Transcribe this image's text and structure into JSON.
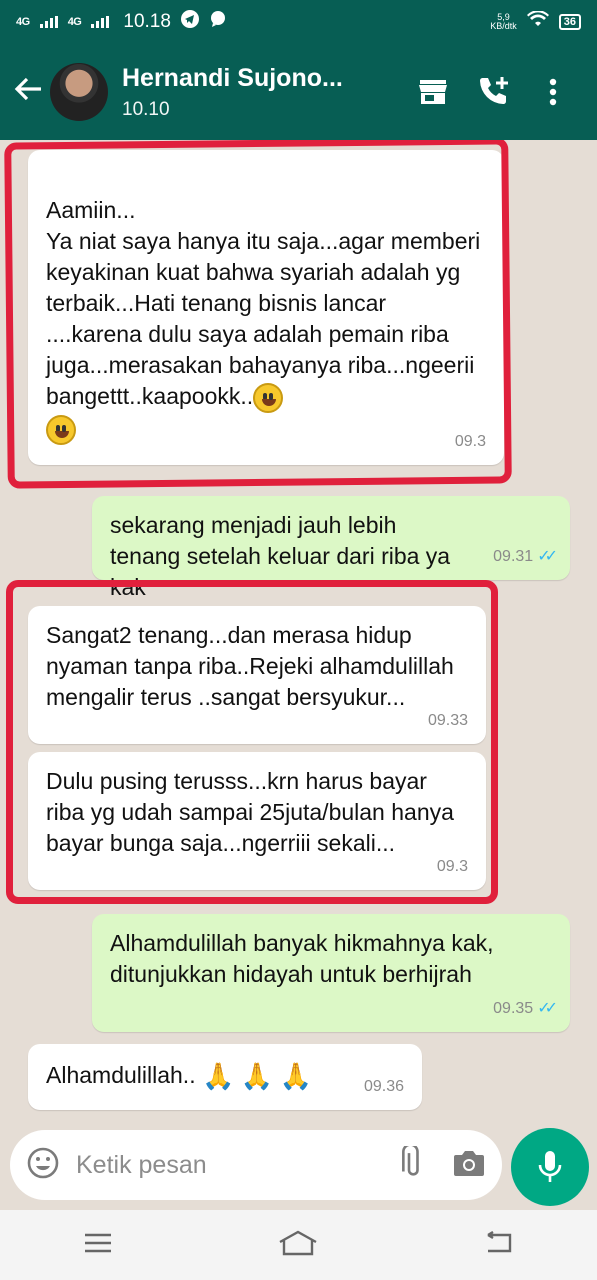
{
  "status_bar": {
    "network1": "4G",
    "network2": "4G",
    "time": "10.18",
    "speed_value": "5,9",
    "speed_unit": "KB/dtk",
    "battery": "36"
  },
  "header": {
    "contact_name": "Hernandi Sujono...",
    "last_seen": "10.10"
  },
  "messages": [
    {
      "id": "m1",
      "direction": "incoming",
      "text": "Aamiin...\nYa niat saya hanya itu saja...agar memberi keyakinan kuat bahwa syariah adalah yg terbaik...Hati tenang bisnis lancar  ....karena dulu saya adalah pemain riba juga...merasakan bahayanya riba...ngeerii bangettt..kaapookk..",
      "emoji_count": 2,
      "time": "09.3"
    },
    {
      "id": "m2",
      "direction": "outgoing",
      "text": "sekarang menjadi jauh lebih tenang setelah keluar dari riba ya kak",
      "time": "09.31",
      "read": true
    },
    {
      "id": "m3",
      "direction": "incoming",
      "text": "Sangat2 tenang...dan merasa hidup nyaman tanpa riba..Rejeki alhamdulillah mengalir terus ..sangat bersyukur...",
      "time": "09.33"
    },
    {
      "id": "m4",
      "direction": "incoming",
      "text": "Dulu pusing terusss...krn harus bayar riba yg udah sampai 25juta/bulan hanya bayar bunga saja...ngerriii sekali...",
      "time": "09.3"
    },
    {
      "id": "m5",
      "direction": "outgoing",
      "text": "Alhamdulillah banyak hikmahnya kak, ditunjukkan hidayah untuk berhijrah",
      "time": "09.35",
      "read": true
    },
    {
      "id": "m6",
      "direction": "incoming",
      "text": "Alhamdulillah..",
      "emoji_count": 3,
      "time": "09.36"
    }
  ],
  "input": {
    "placeholder": "Ketik pesan"
  },
  "colors": {
    "header": "#075e54",
    "incoming": "#ffffff",
    "outgoing": "#dcf8c6",
    "highlight": "#e0203c",
    "mic": "#00a884"
  }
}
